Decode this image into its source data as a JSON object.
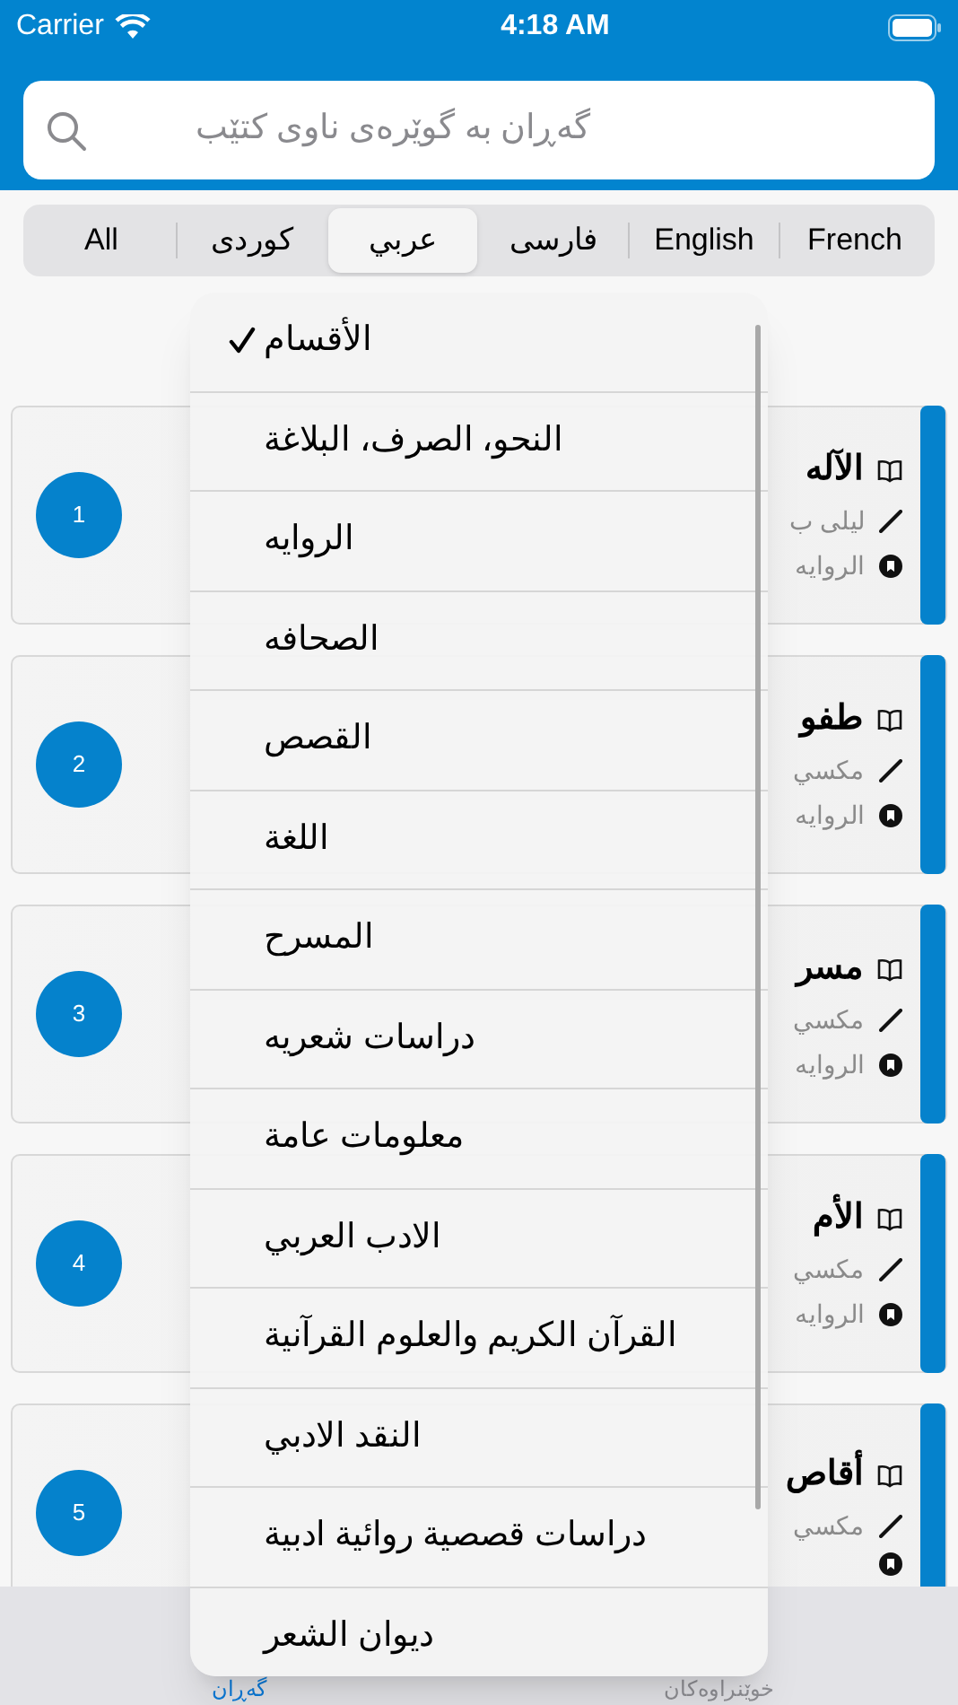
{
  "status_bar": {
    "carrier": "Carrier",
    "time": "4:18 AM"
  },
  "search": {
    "placeholder": "گەڕان بە گوێرەی ناوی کتێب"
  },
  "segments": [
    {
      "label": "French",
      "selected": false
    },
    {
      "label": "English",
      "selected": false
    },
    {
      "label": "فارسی",
      "selected": false
    },
    {
      "label": "عربي",
      "selected": true
    },
    {
      "label": "کوردی",
      "selected": false
    },
    {
      "label": "All",
      "selected": false
    }
  ],
  "books": [
    {
      "number": "1",
      "title": "الآله",
      "author": "ليلى ب",
      "category": "الروايه"
    },
    {
      "number": "2",
      "title": "طفو",
      "author": "مكسي",
      "category": "الروايه"
    },
    {
      "number": "3",
      "title": "مسر",
      "author": "مكسي",
      "category": "الروايه"
    },
    {
      "number": "4",
      "title": "الأم",
      "author": "مكسي",
      "category": "الروايه"
    },
    {
      "number": "5",
      "title": "أقاص",
      "author": "مكسي"
    }
  ],
  "menu": {
    "items": [
      {
        "label": "الأقسام",
        "checked": true
      },
      {
        "label": "النحو، الصرف، البلاغة",
        "checked": false
      },
      {
        "label": "الروايه",
        "checked": false
      },
      {
        "label": "الصحافه",
        "checked": false
      },
      {
        "label": "القصص",
        "checked": false
      },
      {
        "label": "اللغة",
        "checked": false
      },
      {
        "label": "المسرح",
        "checked": false
      },
      {
        "label": "دراسات شعريه",
        "checked": false
      },
      {
        "label": "معلومات عامة",
        "checked": false
      },
      {
        "label": "الادب العربي",
        "checked": false
      },
      {
        "label": "القرآن الكريم والعلوم القرآنية",
        "checked": false
      },
      {
        "label": "النقد الادبي",
        "checked": false
      },
      {
        "label": "دراسات قصصية روائية ادبية",
        "checked": false
      },
      {
        "label": "ديوان الشعر",
        "checked": false
      }
    ]
  },
  "tab_bar": [
    {
      "label": "خوێنراوەکان",
      "selected": false
    },
    {
      "label": "گەڕان",
      "selected": true
    }
  ]
}
